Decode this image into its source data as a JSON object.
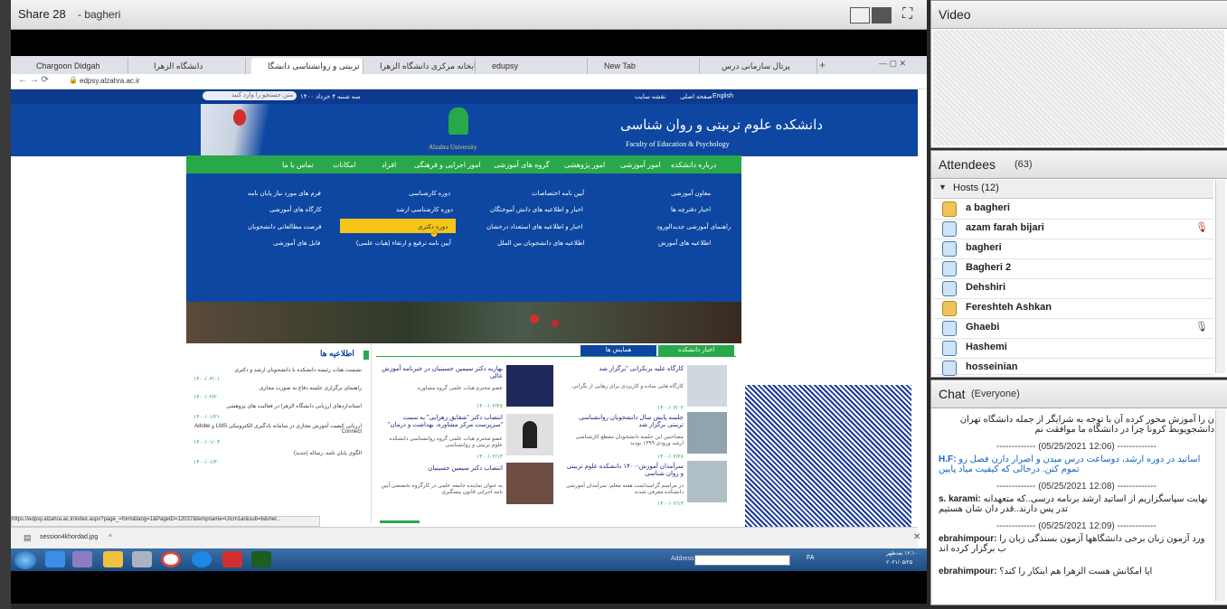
{
  "share": {
    "title": "Share 28",
    "presenter": "- bagheri"
  },
  "browser": {
    "tabs": [
      "Chargoon Didgah",
      "دانشگاه الزهرا",
      "دانشکده علوم تربیتی و روانشناسی دانشگا",
      "ک‌تریستاس کتابخانه مرکزی دانشگاه الزهرا",
      "edupsy",
      "New Tab",
      "پرتال سازمانی درس"
    ],
    "url": "edpsy.alzahra.ac.ir",
    "status_url": "https://edpsy.alzahra.ac.ir/index.aspx?page_=form&lang=1&PageID=12037&tempname=Ulcm1ar&sub=b&met..."
  },
  "site": {
    "topbar": {
      "lang": "English",
      "home": "صفحه اصلی",
      "sitemap": "نقشه سایت",
      "date": "سه شنبه ۴ خرداد ۱۴۰۰",
      "search_placeholder": "متن جستجو را وارد کنید"
    },
    "faculty_fa": "دانشکده علوم تربیتی و روان شناسی",
    "faculty_en": "Faculty of Education & Psychology",
    "university": "Alzahra University",
    "nav": [
      "درباره دانشکده",
      "امور آموزشی",
      "امور پژوهشی",
      "گروه های آموزشی",
      "امور اجرایی و فرهنگی",
      "افراد",
      "امکانات",
      "تماس با ما"
    ],
    "mega": {
      "col1": [
        "معاون آموزشی",
        "اخبار دفترچه ها",
        "راهنمای آموزشی جدیدالورود",
        "اطلاعیه های آموزش"
      ],
      "col2": [
        "آیین نامه اختصاصات",
        "اخبار و اطلاعیه های دانش آموختگان",
        "اخبار و اطلاعیه های استعداد درخشان",
        "اطلاعیه های دانشجویان بین الملل"
      ],
      "col3": [
        "دوره کارشناسی",
        "دوره کارشناسی ارشد",
        "دوره دکتری",
        "آیین نامه ترفیع و ارتقاء (هیات علمی)"
      ],
      "col4": [
        "فرم های مورد نیاز پایان نامه",
        "کارگاه های آموزشی",
        "فرصت مطالعاتی دانشجویان",
        "فایل های آموزشی"
      ]
    },
    "tabs": [
      "اخبار دانشکده",
      "همایش ها"
    ],
    "news": [
      {
        "title": "کارگاه علیه برنکرانی \"برگزار شد",
        "desc": "کارگاه هایی ساده و کاربردی برای رهایی از نگرانی",
        "date": "۱۴۰۰/۰۳/۰۲"
      },
      {
        "title": "جلسه پایش سال دانشجویان روانشناسی تربیتی برگزار شد",
        "desc": "مصاحبین این جلسه دانشجویان مقطع کارشناسی ارشد ورودی ۱۳۹۹ بودند",
        "date": "۱۴۰۰/۰۲/۲۸"
      },
      {
        "title": "سرآمدان آموزش-۱۴۰۰ دانشکده علوم تربیتی و روان شناسی",
        "desc": "در مراسم گرامیداشت هفته معلم، سرآمدان آموزشی دانشکده معرفی شدند",
        "date": "۱۴۰۰/۰۲/۱۳"
      }
    ],
    "news2": [
      {
        "title": "بهاریه دکتر سیمین حسینیان در خبرنامه آموزش عالی",
        "desc": "عضو محترم هیات علمی گروه مشاوره",
        "date": "۱۴۰۰/۰۲/۲۷"
      },
      {
        "title": "انتصاب دکتر \"شقایق زهرایی\" به سمت \"سرپرست مرکز مشاوره، بهداشت و درمان\"",
        "desc": "عضو محترم هیات علمی گروه روانشناسی دانشکده علوم تربیتی و روانشناسی",
        "date": "۱۴۰۰/۰۲/۱۴"
      },
      {
        "title": "انتصاب دکتر سیمین حسینیان",
        "desc": "به عنوان نماینده جامعه علمی در کارگروه تخصصی آیین نامه اجرایی قانون پیشگیری",
        "date": ""
      }
    ],
    "announce_title": "اطلاعیه ها",
    "announcements": [
      {
        "text": "نشست هیات رئیسه دانشکده با دانشجویان ارشد و دکتری",
        "date": "۱۴۰۰/۰۳/۰۱"
      },
      {
        "text": "راهنمای برگزاری جلسه دفاع به صورت مجازی",
        "date": "۱۴۰۰/۰۲/۲۰"
      },
      {
        "text": "استانداردهای ارزیابی دانشگاه الزهرا در فعالیت های پژوهشی",
        "date": "۱۴۰۰/۰۱/۲۱"
      },
      {
        "text": "ارزیابی کیفیت آموزش مجازی در سامانه یادگیری الکترونیکی LMS و Adobe Connect",
        "date": "۱۴۰۰/۰۱/۰۴"
      },
      {
        "text": "الگوی پایان نامه، رساله (جدید)",
        "date": "۱۴۰۰/۰۱/۳۰"
      }
    ]
  },
  "downloads": {
    "file": "session4khordad.jpg"
  },
  "taskbar": {
    "address_label": "Address",
    "lang": "FA",
    "time": "۱۲:۱۰ بعدظهر",
    "date": "۲۰۲۱/۰۵/۲۵"
  },
  "video": {
    "title": "Video"
  },
  "attendees": {
    "title": "Attendees",
    "count": "(63)",
    "hosts_label": "Hosts (12)",
    "list": [
      "a bagheri",
      "azam farah bijari",
      "bagheri",
      "Bagheri 2",
      "Dehshiri",
      "Fereshteh Ashkan",
      "Ghaebi",
      "Hashemi",
      "hosseinian"
    ]
  },
  "chat": {
    "title": "Chat",
    "scope": "(Everyone)",
    "lines": [
      {
        "text": "ن را آموزش محور کرده آن  با توجه به شرایگر از جمله دانشگاه  تهران دانشجویوبط کرونا چرا در دانشگاه  ما موافقت نم"
      },
      {
        "text": "------------- (05/25/2021 12:06) -------------",
        "stamp": true
      },
      {
        "sender": "H.F:",
        "text": " اساتید در دوره ارشد، دوساعت درس مبدن و اصرار دارن فصل رو تموم کنن. درحالی که کیفیت میاد پایین",
        "blue": true
      },
      {
        "text": "------------- (05/25/2021 12:08) -------------",
        "stamp": true
      },
      {
        "sender": "s. karami:",
        "text": " نهایت سپاسگزاریم از اساتید ارشد برنامه درسی..که متعهدانه تدر پس دارند..قدر دان شان هستیم"
      },
      {
        "text": "------------- (05/25/2021 12:09) -------------",
        "stamp": true
      },
      {
        "sender": "ebrahimpour:",
        "text": " ورد آزمون زبان برخی دانشگاهها آزمون بسنذگی زبان را ب برگزار کرده اند"
      },
      {
        "sender": "ebrahimpour:",
        "text": " ایا امکانش هست الزهرا هم اینکار را کند؟"
      }
    ]
  }
}
